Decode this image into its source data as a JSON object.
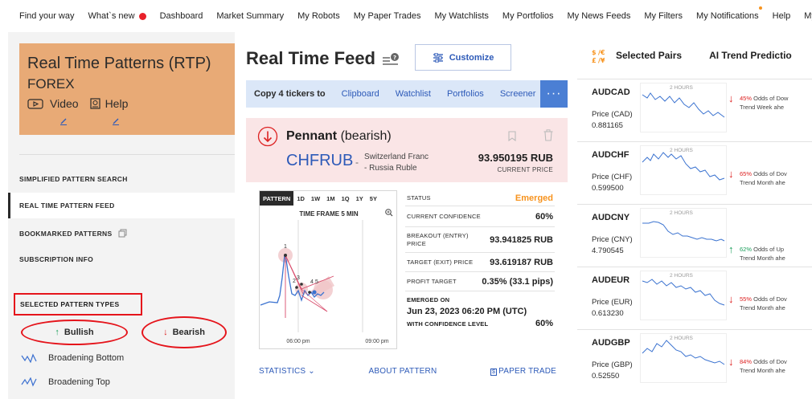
{
  "nav": [
    "Find your way",
    "What`s new",
    "Dashboard",
    "Market Summary",
    "My Robots",
    "My Paper Trades",
    "My Watchlists",
    "My Portfolios",
    "My News Feeds",
    "My Filters",
    "My Notifications",
    "Help",
    "My Br"
  ],
  "sidebar": {
    "title": "Real Time Patterns (RTP)",
    "subtitle": "FOREX",
    "video_label": "Video",
    "help_label": "Help",
    "items": [
      "SIMPLIFIED PATTERN SEARCH",
      "REAL TIME PATTERN FEED",
      "BOOKMARKED PATTERNS",
      "SUBSCRIPTION INFO"
    ],
    "pattern_types_label": "SELECTED PATTERN TYPES",
    "bullish": "Bullish",
    "bearish": "Bearish",
    "patterns": [
      "Broadening Bottom",
      "Broadening Top"
    ]
  },
  "feed": {
    "title": "Real Time Feed",
    "customize": "Customize",
    "copy_label": "Copy 4 tickers to",
    "copy_targets": [
      "Clipboard",
      "Watchlist",
      "Portfolios",
      "Screener"
    ],
    "more": "···"
  },
  "card": {
    "pattern": "Pennant",
    "direction": "(bearish)",
    "ticker": "CHFRUB",
    "dash": "-",
    "desc_line1": "Switzerland Franc",
    "desc_line2": "- Russia Ruble",
    "price": "93.950195 RUB",
    "price_label": "CURRENT PRICE",
    "timeframes": [
      "PATTERN",
      "1D",
      "1W",
      "1M",
      "1Q",
      "1Y",
      "5Y"
    ],
    "chart_title": "TIME FRAME 5 MIN",
    "x_ticks": [
      "06:00 pm",
      "09:00 pm"
    ],
    "point_labels": [
      "1",
      "2",
      "3",
      "4",
      "5"
    ],
    "details": {
      "status_label": "STATUS",
      "status": "Emerged",
      "confidence_label": "CURRENT CONFIDENCE",
      "confidence": "60%",
      "breakout_label_1": "BREAKOUT (ENTRY)",
      "breakout_label_2": "PRICE",
      "breakout": "93.941825 RUB",
      "target_label": "TARGET (EXIT) PRICE",
      "target": "93.619187 RUB",
      "profit_label": "PROFIT TARGET",
      "profit": "0.35% (33.1 pips)",
      "emerged_label": "EMERGED ON",
      "emerged": "Jun 23, 2023 06:20 PM (UTC)",
      "with_conf_label": "WITH CONFIDENCE LEVEL",
      "with_conf": "60%"
    },
    "statistics": "STATISTICS",
    "about": "ABOUT PATTERN",
    "paper_trade": "PAPER TRADE"
  },
  "right": {
    "header": "Selected Pairs",
    "header2": "AI Trend Predictio",
    "spark_label": "2 HOURS",
    "pairs": [
      {
        "symbol": "AUDCAD",
        "price_label": "Price (CAD)",
        "price": "0.881165",
        "pct": "45%",
        "odds_text": "Odds of Dow",
        "trend": "Trend Week ahe",
        "dir": "down"
      },
      {
        "symbol": "AUDCHF",
        "price_label": "Price (CHF)",
        "price": "0.599500",
        "pct": "65%",
        "odds_text": "Odds of Dov",
        "trend": "Trend Month ahe",
        "dir": "down"
      },
      {
        "symbol": "AUDCNY",
        "price_label": "Price (CNY)",
        "price": "4.790545",
        "pct": "62%",
        "odds_text": "Odds of Up",
        "trend": "Trend Month ahe",
        "dir": "up"
      },
      {
        "symbol": "AUDEUR",
        "price_label": "Price (EUR)",
        "price": "0.613230",
        "pct": "55%",
        "odds_text": "Odds of Dov",
        "trend": "Trend Month ahe",
        "dir": "down"
      },
      {
        "symbol": "AUDGBP",
        "price_label": "Price (GBP)",
        "price": "0.52550",
        "pct": "84%",
        "odds_text": "Odds of Dov",
        "trend": "Trend Month ahe",
        "dir": "down"
      }
    ]
  },
  "colors": {
    "accent": "#2d5ab8",
    "rtp_bg": "#e8aa76",
    "bear_bg": "#fae5e6",
    "emerged": "#f7931e",
    "highlight": "#e5141b"
  }
}
